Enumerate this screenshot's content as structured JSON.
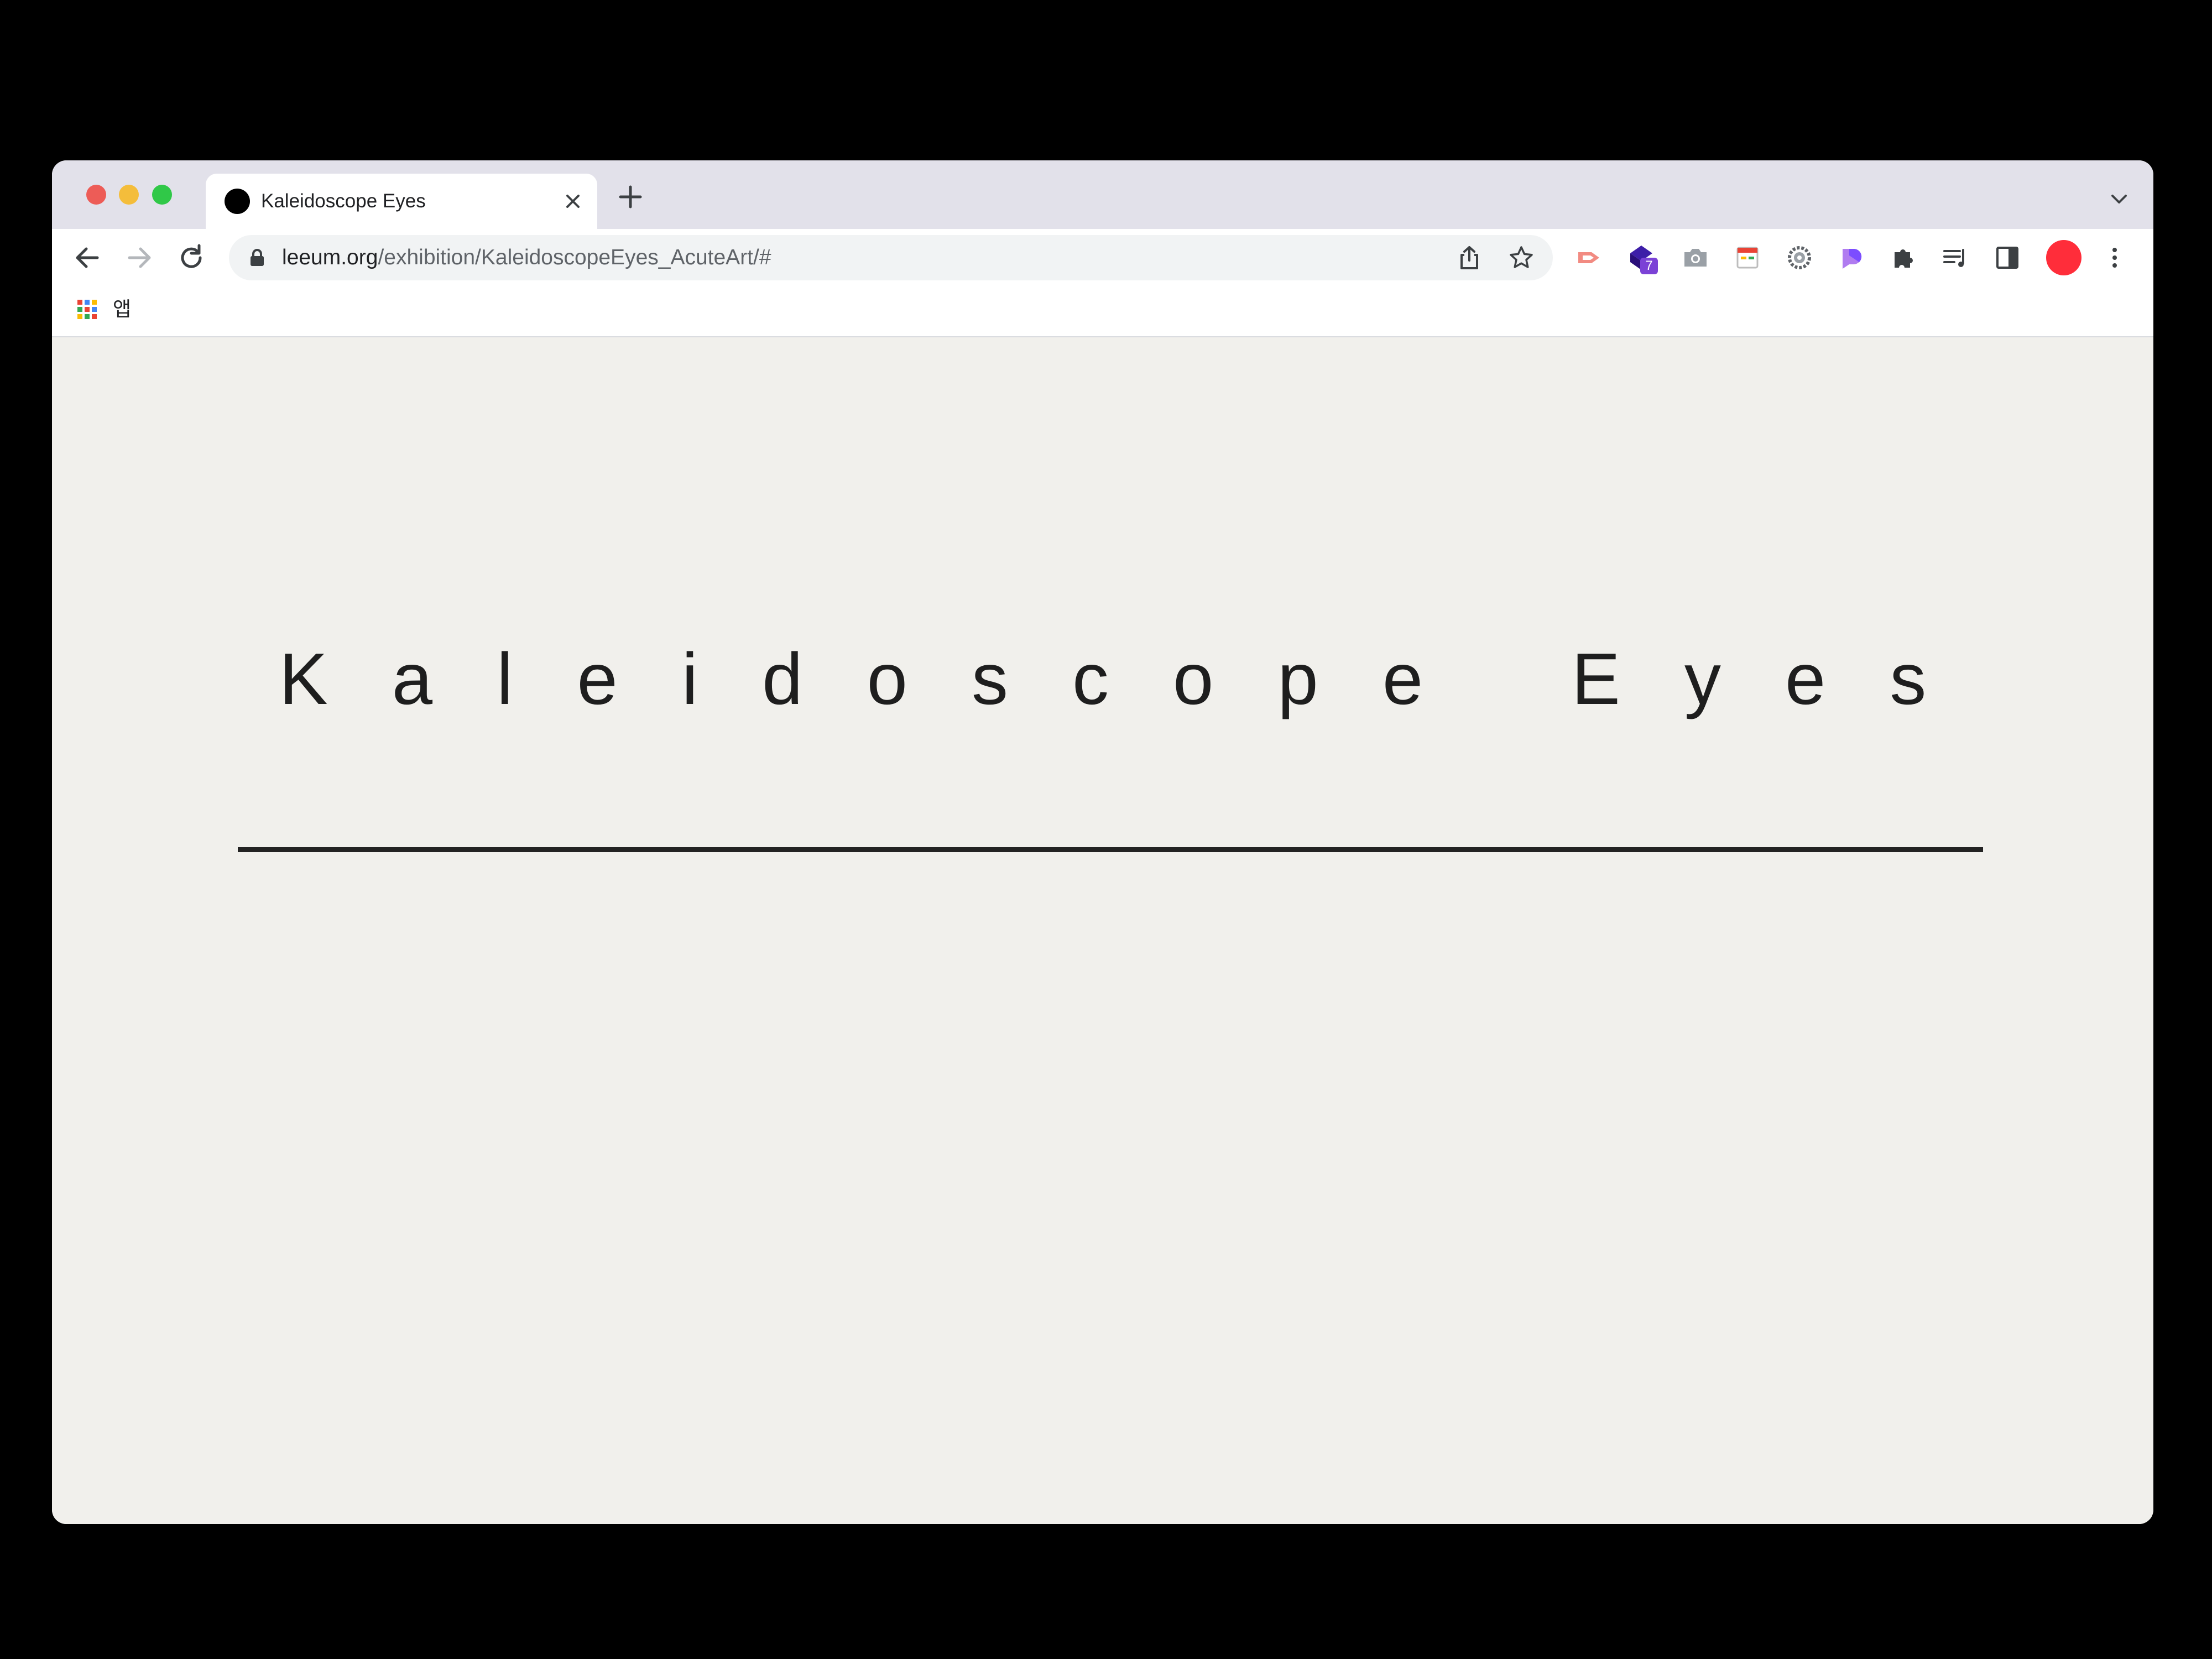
{
  "browser": {
    "tab": {
      "title": "Kaleidoscope Eyes"
    },
    "address_bar": {
      "host": "leeum.org",
      "path": "/exhibition/KaleidoscopeEyes_AcuteArt/#"
    },
    "extensions": {
      "badge_count": "7"
    },
    "bookmarks": {
      "apps_label": "앱"
    },
    "profile_color": "#ff2d3a"
  },
  "page": {
    "title": "Kaleidoscope Eyes",
    "background": "#f1f0ec"
  }
}
